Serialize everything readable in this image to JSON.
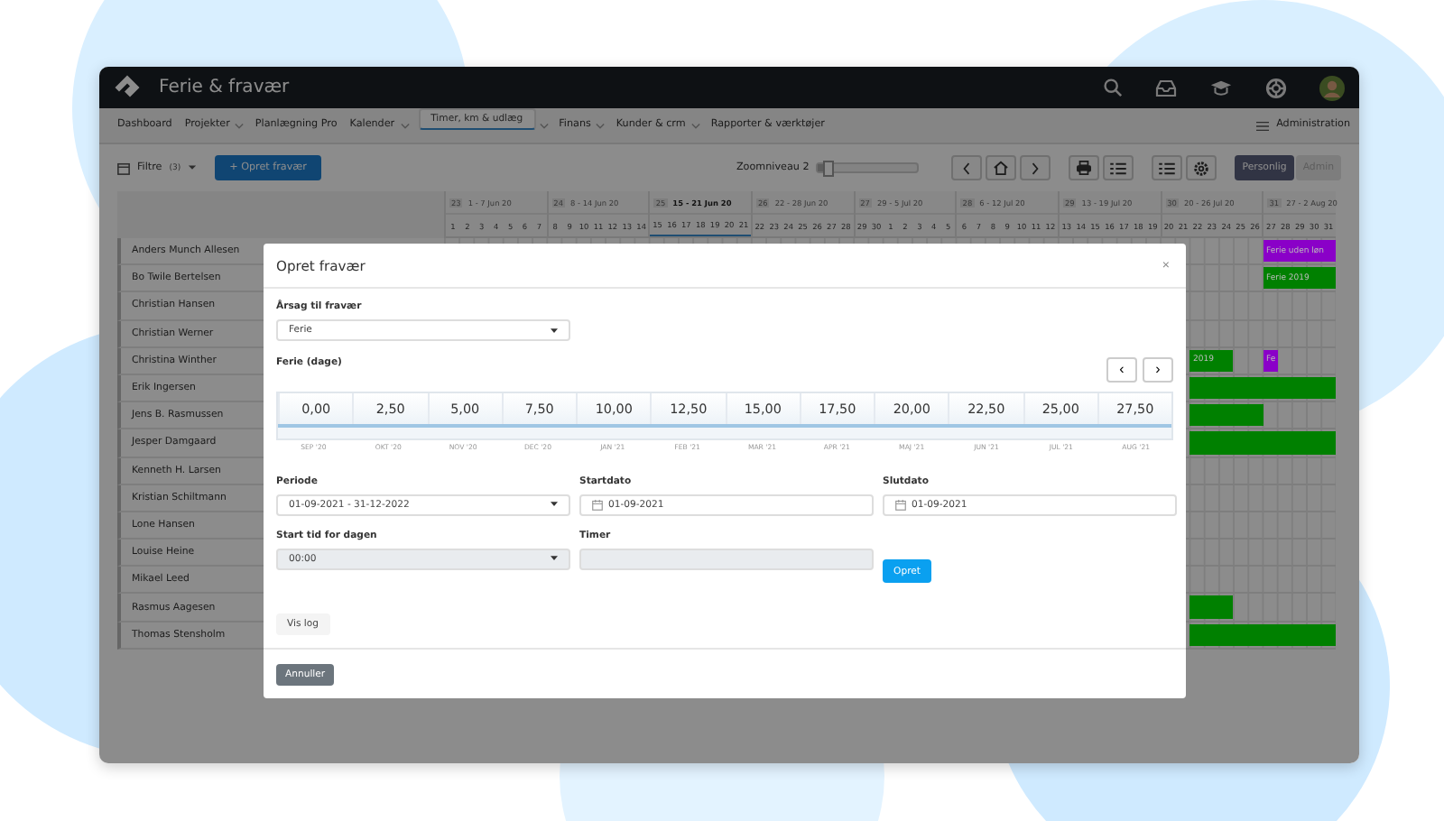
{
  "app": {
    "title": "Ferie & fravær"
  },
  "nav": [
    {
      "label": "Dashboard",
      "dropdown": false,
      "selected": false
    },
    {
      "label": "Projekter",
      "dropdown": true,
      "selected": false
    },
    {
      "label": "Planlægning Pro",
      "dropdown": false,
      "selected": false
    },
    {
      "label": "Kalender",
      "dropdown": true,
      "selected": false
    },
    {
      "label": "Timer, km & udlæg",
      "dropdown": true,
      "selected": true
    },
    {
      "label": "Finans",
      "dropdown": true,
      "selected": false
    },
    {
      "label": "Kunder & crm",
      "dropdown": true,
      "selected": false
    },
    {
      "label": "Rapporter & værktøjer",
      "dropdown": false,
      "selected": false
    }
  ],
  "nav_right": "Administration",
  "toolbar": {
    "filter": "Filtre",
    "filter_count": "(3)",
    "create": "+ Opret fravær",
    "zoom_label": "Zoomniveau 2",
    "zoom": {
      "level": 0.05
    },
    "view_toggle": [
      {
        "label": "Personlig",
        "selected": true
      },
      {
        "label": "Admin",
        "selected": false
      }
    ]
  },
  "calendar": {
    "weeks": [
      {
        "number": "23",
        "label": "1 - 7 Jun 20",
        "current": false,
        "days": [
          "1",
          "2",
          "3",
          "4",
          "5",
          "6",
          "7"
        ]
      },
      {
        "number": "24",
        "label": "8 - 14 Jun 20",
        "current": false,
        "days": [
          "8",
          "9",
          "10",
          "11",
          "12",
          "13",
          "14"
        ]
      },
      {
        "number": "25",
        "label": "15 - 21 Jun 20",
        "current": true,
        "days": [
          "15",
          "16",
          "17",
          "18",
          "19",
          "20",
          "21"
        ]
      },
      {
        "number": "26",
        "label": "22 - 28 Jun 20",
        "current": false,
        "days": [
          "22",
          "23",
          "24",
          "25",
          "26",
          "27",
          "28"
        ]
      },
      {
        "number": "27",
        "label": "29 - 5 Jul 20",
        "current": false,
        "days": [
          "29",
          "30",
          "1",
          "2",
          "3",
          "4",
          "5"
        ]
      },
      {
        "number": "28",
        "label": "6 - 12 Jul 20",
        "current": false,
        "days": [
          "6",
          "7",
          "8",
          "9",
          "10",
          "11",
          "12"
        ]
      },
      {
        "number": "29",
        "label": "13 - 19 Jul 20",
        "current": false,
        "days": [
          "13",
          "14",
          "15",
          "16",
          "17",
          "18",
          "19"
        ]
      },
      {
        "number": "30",
        "label": "20 - 26 Jul 20",
        "current": false,
        "days": [
          "20",
          "21",
          "22",
          "23",
          "24",
          "25",
          "26"
        ]
      },
      {
        "number": "31",
        "label": "27 - 2 Aug 20",
        "current": false,
        "days": [
          "27",
          "28",
          "29",
          "30",
          "31"
        ]
      }
    ],
    "rows": [
      {
        "name": "Anders Munch Allesen",
        "cells": [
          null,
          null,
          null,
          null,
          null,
          null,
          null,
          null,
          null,
          null,
          null,
          null,
          null,
          null,
          null,
          null,
          null,
          null,
          null,
          null,
          null,
          null,
          null,
          null,
          null,
          null,
          null,
          null,
          null,
          null,
          null,
          null,
          null,
          null,
          null,
          null,
          null,
          null,
          null,
          null,
          null,
          null,
          null,
          null,
          null,
          null,
          null,
          null,
          null,
          null,
          null,
          null,
          null,
          null,
          null,
          null,
          {
            "label": "Ferie uden løn",
            "color": "#8a00c8"
          },
          {
            "color": "#8a00c8"
          },
          {
            "color": "#8a00c8"
          },
          {
            "color": "#8a00c8"
          },
          {
            "color": "#8a00c8"
          }
        ]
      },
      {
        "name": "Bo Twile Bertelsen",
        "cells": [
          null,
          null,
          null,
          null,
          null,
          null,
          null,
          null,
          null,
          null,
          null,
          null,
          null,
          null,
          null,
          null,
          null,
          null,
          null,
          null,
          null,
          null,
          null,
          null,
          null,
          null,
          null,
          null,
          null,
          null,
          null,
          null,
          null,
          null,
          null,
          null,
          null,
          null,
          null,
          null,
          null,
          null,
          null,
          null,
          null,
          null,
          null,
          null,
          null,
          null,
          null,
          null,
          null,
          null,
          null,
          null,
          {
            "label": "Ferie 2019",
            "color": "#008000"
          },
          {
            "color": "#008000"
          },
          {
            "color": "#008000"
          },
          {
            "color": "#008000"
          },
          {
            "color": "#008000"
          }
        ]
      },
      {
        "name": "Christian Hansen"
      },
      {
        "name": "Christian Werner"
      },
      {
        "name": "Christina Winther",
        "cells": [
          null,
          null,
          null,
          null,
          null,
          null,
          null,
          null,
          null,
          null,
          null,
          null,
          null,
          null,
          null,
          null,
          null,
          null,
          null,
          null,
          null,
          null,
          null,
          null,
          null,
          null,
          null,
          null,
          null,
          null,
          null,
          null,
          null,
          null,
          null,
          null,
          null,
          null,
          null,
          null,
          null,
          null,
          null,
          null,
          null,
          null,
          null,
          null,
          null,
          null,
          null,
          {
            "label": "2019",
            "color": "#008000"
          },
          {
            "color": "#008000"
          },
          {
            "color": "#008000"
          },
          null,
          null,
          {
            "label": "Fe",
            "color": "#8a00c8"
          },
          null,
          null,
          null,
          null
        ]
      },
      {
        "name": "Erik Ingersen",
        "cells": [
          null,
          null,
          null,
          null,
          null,
          null,
          null,
          null,
          null,
          null,
          null,
          null,
          null,
          null,
          null,
          null,
          null,
          null,
          null,
          null,
          null,
          null,
          null,
          null,
          null,
          null,
          null,
          null,
          null,
          null,
          null,
          null,
          null,
          null,
          null,
          null,
          null,
          null,
          null,
          null,
          null,
          null,
          null,
          null,
          null,
          null,
          null,
          null,
          null,
          null,
          null,
          {
            "color": "#008000"
          },
          {
            "color": "#008000"
          },
          {
            "color": "#008000"
          },
          {
            "color": "#008000"
          },
          {
            "color": "#008000"
          },
          {
            "color": "#008000"
          },
          {
            "color": "#008000"
          },
          {
            "color": "#008000"
          },
          {
            "color": "#008000"
          },
          {
            "color": "#008000"
          }
        ]
      },
      {
        "name": "Jens B. Rasmussen",
        "cells": [
          null,
          null,
          null,
          null,
          null,
          null,
          null,
          null,
          null,
          null,
          null,
          null,
          null,
          null,
          null,
          null,
          null,
          null,
          null,
          null,
          null,
          null,
          null,
          null,
          null,
          null,
          null,
          null,
          null,
          null,
          null,
          null,
          null,
          null,
          null,
          null,
          null,
          null,
          null,
          null,
          null,
          null,
          null,
          null,
          null,
          null,
          null,
          null,
          null,
          null,
          null,
          {
            "color": "#008000"
          },
          {
            "color": "#008000"
          },
          {
            "color": "#008000"
          },
          {
            "color": "#008000"
          },
          {
            "color": "#008000"
          },
          null,
          null,
          null,
          null,
          null
        ]
      },
      {
        "name": "Jesper Damgaard",
        "cells": [
          null,
          null,
          null,
          null,
          null,
          null,
          null,
          null,
          null,
          null,
          null,
          null,
          null,
          null,
          null,
          null,
          null,
          null,
          null,
          null,
          null,
          null,
          null,
          null,
          null,
          null,
          null,
          null,
          null,
          null,
          null,
          null,
          null,
          null,
          null,
          null,
          null,
          null,
          null,
          null,
          null,
          null,
          null,
          null,
          null,
          null,
          null,
          null,
          null,
          null,
          null,
          {
            "color": "#008000"
          },
          {
            "color": "#008000"
          },
          {
            "color": "#008000"
          },
          {
            "color": "#008000"
          },
          {
            "color": "#008000"
          },
          {
            "color": "#008000"
          },
          {
            "color": "#008000"
          },
          {
            "color": "#008000"
          },
          {
            "color": "#008000"
          },
          {
            "color": "#008000"
          }
        ]
      },
      {
        "name": "Kenneth H. Larsen"
      },
      {
        "name": "Kristian Schiltmann"
      },
      {
        "name": "Lone Hansen"
      },
      {
        "name": "Louise Heine"
      },
      {
        "name": "Mikael Leed"
      },
      {
        "name": "Rasmus Aagesen",
        "cells": [
          null,
          null,
          null,
          null,
          null,
          null,
          null,
          null,
          null,
          null,
          null,
          null,
          null,
          null,
          null,
          null,
          null,
          null,
          null,
          null,
          null,
          null,
          null,
          null,
          null,
          null,
          null,
          null,
          null,
          null,
          null,
          null,
          null,
          null,
          null,
          null,
          null,
          null,
          null,
          null,
          null,
          null,
          null,
          null,
          null,
          null,
          null,
          null,
          null,
          null,
          null,
          {
            "color": "#008000"
          },
          {
            "color": "#008000"
          },
          {
            "color": "#008000"
          },
          null,
          null,
          null,
          null,
          null,
          null,
          null
        ]
      },
      {
        "name": "Thomas Stensholm",
        "cells": [
          null,
          null,
          null,
          null,
          null,
          null,
          null,
          null,
          null,
          null,
          null,
          null,
          null,
          null,
          null,
          null,
          null,
          null,
          null,
          null,
          null,
          null,
          null,
          null,
          null,
          null,
          null,
          null,
          null,
          null,
          null,
          null,
          null,
          null,
          null,
          null,
          null,
          null,
          null,
          null,
          null,
          null,
          null,
          null,
          null,
          null,
          null,
          null,
          null,
          null,
          null,
          {
            "color": "#008000"
          },
          {
            "color": "#008000"
          },
          {
            "color": "#008000"
          },
          {
            "color": "#008000"
          },
          {
            "color": "#008000"
          },
          {
            "color": "#008000"
          },
          {
            "color": "#008000"
          },
          {
            "color": "#008000"
          },
          {
            "color": "#008000"
          },
          {
            "color": "#008000"
          }
        ]
      }
    ]
  },
  "modal": {
    "title": "Opret fravær",
    "close": "×",
    "reason": {
      "label": "Årsag til fravær",
      "value": "Ferie"
    },
    "balance": {
      "label": "Ferie (dage)",
      "prev": "‹",
      "next": "›",
      "columns": [
        {
          "value": "0,00",
          "month": "SEP '20"
        },
        {
          "value": "2,50",
          "month": "OKT '20"
        },
        {
          "value": "5,00",
          "month": "NOV '20"
        },
        {
          "value": "7,50",
          "month": "DEC '20"
        },
        {
          "value": "10,00",
          "month": "JAN '21"
        },
        {
          "value": "12,50",
          "month": "FEB '21"
        },
        {
          "value": "15,00",
          "month": "MAR '21"
        },
        {
          "value": "17,50",
          "month": "APR '21"
        },
        {
          "value": "20,00",
          "month": "MAJ '21"
        },
        {
          "value": "22,50",
          "month": "JUN '21"
        },
        {
          "value": "25,00",
          "month": "JUL '21"
        },
        {
          "value": "27,50",
          "month": "AUG '21"
        }
      ]
    },
    "fields": [
      {
        "kind": "select",
        "label": "Periode",
        "value": "01-09-2021 - 31-12-2022",
        "disabled": false
      },
      {
        "kind": "date",
        "label": "Startdato",
        "value": "01-09-2021",
        "disabled": false
      },
      {
        "kind": "date",
        "label": "Slutdato",
        "value": "01-09-2021",
        "disabled": false
      },
      {
        "kind": "select",
        "label": "Start tid for dagen",
        "value": "00:00",
        "disabled": true
      },
      {
        "kind": "text",
        "label": "Timer",
        "disabled": true
      },
      {
        "kind": "button",
        "label": "Opret",
        "disabled": false
      }
    ],
    "log_button": "Vis log",
    "cancel_button": "Annuller"
  }
}
